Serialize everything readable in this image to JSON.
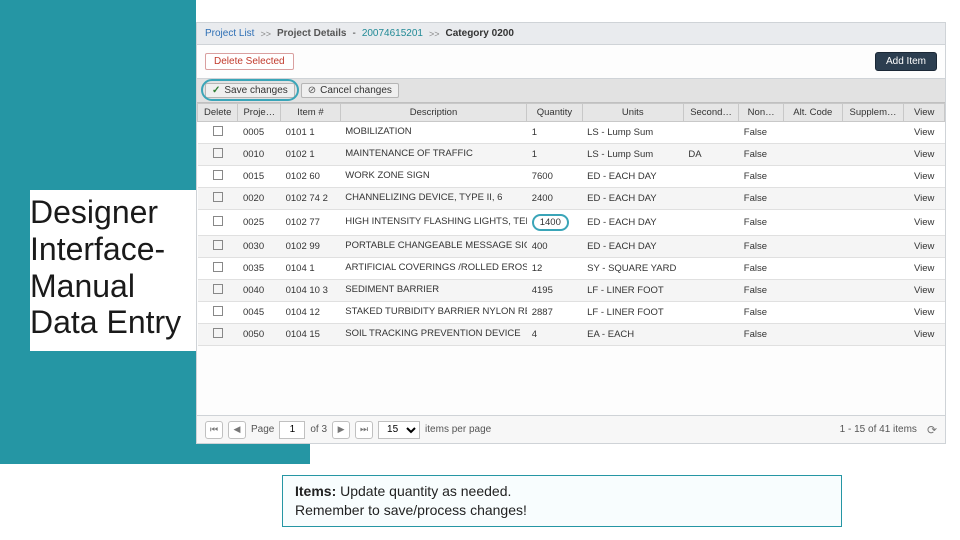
{
  "title": "Designer Interface- Manual Data Entry",
  "breadcrumb": {
    "project_list": "Project List",
    "project_details": "Project Details",
    "project_number": "20074615201",
    "category_label": "Category 0200"
  },
  "actions": {
    "delete_selected": "Delete Selected",
    "add_item": "Add Item"
  },
  "savebar": {
    "save": "Save changes",
    "cancel": "Cancel changes"
  },
  "headers": {
    "delete": "Delete",
    "proj": "Proje…",
    "item": "Item #",
    "desc": "Description",
    "qty": "Quantity",
    "units": "Units",
    "second": "Second…",
    "non": "Non…",
    "alt": "Alt. Code",
    "supp": "Supplem…",
    "view": "View"
  },
  "rows": [
    {
      "proj": "0005",
      "item": "0101 1",
      "desc": "MOBILIZATION",
      "qty": "1",
      "units": "LS - Lump Sum",
      "second": "",
      "non": "False",
      "alt": "",
      "supp": "",
      "view": "View"
    },
    {
      "proj": "0010",
      "item": "0102 1",
      "desc": "MAINTENANCE OF TRAFFIC",
      "qty": "1",
      "units": "LS - Lump Sum",
      "second": "DA",
      "non": "False",
      "alt": "",
      "supp": "",
      "view": "View"
    },
    {
      "proj": "0015",
      "item": "0102 60",
      "desc": "WORK ZONE SIGN",
      "qty": "7600",
      "units": "ED - EACH DAY",
      "second": "",
      "non": "False",
      "alt": "",
      "supp": "",
      "view": "View"
    },
    {
      "proj": "0020",
      "item": "0102 74 2",
      "desc": "CHANNELIZING DEVICE, TYPE II, 6",
      "qty": "2400",
      "units": "ED - EACH DAY",
      "second": "",
      "non": "False",
      "alt": "",
      "supp": "",
      "view": "View"
    },
    {
      "proj": "0025",
      "item": "0102 77",
      "desc": "HIGH INTENSITY FLASHING LIGHTS, TEMP, TYPE B",
      "qty": "1400",
      "units": "ED - EACH DAY",
      "second": "",
      "non": "False",
      "alt": "",
      "supp": "",
      "view": "View",
      "highlight": true
    },
    {
      "proj": "0030",
      "item": "0102 99",
      "desc": "PORTABLE CHANGEABLE MESSAGE SIGN, TEMPORARY",
      "qty": "400",
      "units": "ED - EACH DAY",
      "second": "",
      "non": "False",
      "alt": "",
      "supp": "",
      "view": "View"
    },
    {
      "proj": "0035",
      "item": "0104 1",
      "desc": "ARTIFICIAL COVERINGS /ROLLED EROSION CONTROL PRODUCTS",
      "qty": "12",
      "units": "SY - SQUARE YARD",
      "second": "",
      "non": "False",
      "alt": "",
      "supp": "",
      "view": "View"
    },
    {
      "proj": "0040",
      "item": "0104 10 3",
      "desc": "SEDIMENT BARRIER",
      "qty": "4195",
      "units": "LF - LINER FOOT",
      "second": "",
      "non": "False",
      "alt": "",
      "supp": "",
      "view": "View"
    },
    {
      "proj": "0045",
      "item": "0104 12",
      "desc": "STAKED TURBIDITY BARRIER NYLON REINFORCED PVC",
      "qty": "2887",
      "units": "LF - LINER FOOT",
      "second": "",
      "non": "False",
      "alt": "",
      "supp": "",
      "view": "View"
    },
    {
      "proj": "0050",
      "item": "0104 15",
      "desc": "SOIL TRACKING PREVENTION DEVICE",
      "qty": "4",
      "units": "EA - EACH",
      "second": "",
      "non": "False",
      "alt": "",
      "supp": "",
      "view": "View"
    }
  ],
  "pager": {
    "page_label": "Page",
    "page": "1",
    "of_total": "of 3",
    "per_page": "15",
    "per_page_label": "items per page",
    "summary": "1 - 15 of 41 items"
  },
  "callout": {
    "bold": "Items:",
    "line1": " Update quantity as needed.",
    "line2": "Remember to save/process changes!"
  }
}
